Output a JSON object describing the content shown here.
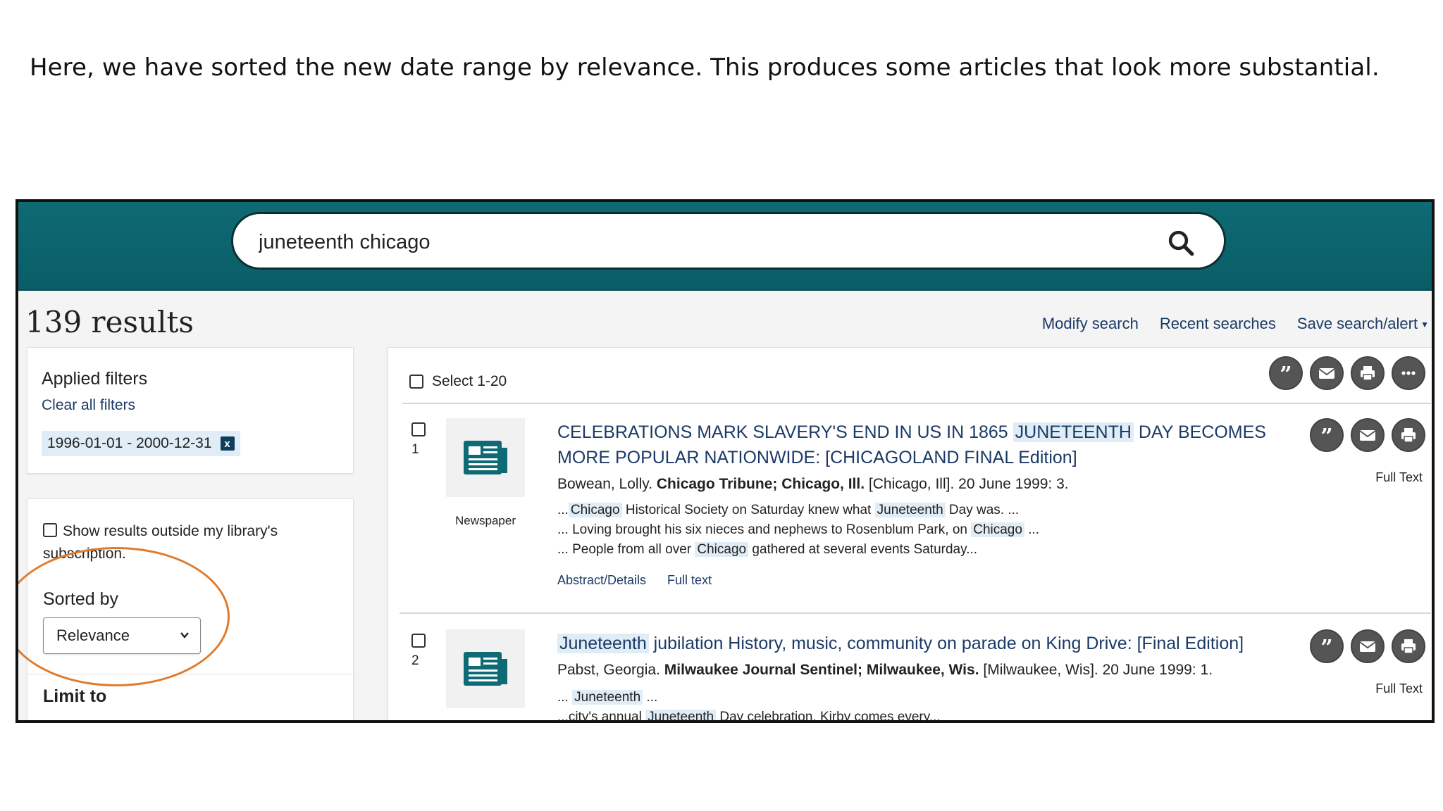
{
  "caption": "Here, we have sorted the new date range by relevance. This produces some articles that look more substantial.",
  "search": {
    "query": "juneteenth chicago"
  },
  "results_count": "139 results",
  "header_links": {
    "modify": "Modify search",
    "recent": "Recent searches",
    "save": "Save search/alert"
  },
  "filters": {
    "title": "Applied filters",
    "clear": "Clear all filters",
    "chip": "1996-01-01 - 2000-12-31",
    "chip_remove": "x"
  },
  "options": {
    "outside": "Show results outside my library's subscription.",
    "sorted_label": "Sorted by",
    "sort_value": "Relevance",
    "limit_label": "Limit to"
  },
  "toolbar": {
    "select_all": "Select 1-20"
  },
  "results": [
    {
      "number": "1",
      "type": "Newspaper",
      "title_pre": "CELEBRATIONS MARK SLAVERY'S END IN US IN 1865 ",
      "title_hl": "JUNETEENTH",
      "title_post": " DAY BECOMES MORE POPULAR NATIONWIDE: [CHICAGOLAND FINAL Edition]",
      "cite_author": "Bowean, Lolly.",
      "cite_pub": "Chicago Tribune; Chicago, Ill.",
      "cite_rest": "[Chicago, Ill]. 20 June 1999: 3.",
      "snip1_a": "...",
      "snip1_h1": "Chicago",
      "snip1_b": " Historical Society on Saturday knew what ",
      "snip1_h2": "Juneteenth",
      "snip1_c": " Day was. ...",
      "snip2_a": "... Loving brought his six nieces and nephews to Rosenblum Park, on ",
      "snip2_h1": "Chicago",
      "snip2_b": " ...",
      "snip3_a": "... People from all over ",
      "snip3_h1": "Chicago",
      "snip3_b": " gathered at several events Saturday...",
      "link_abstract": "Abstract/Details",
      "link_fulltext": "Full text",
      "fulltext_label": "Full Text"
    },
    {
      "number": "2",
      "title_hl": "Juneteenth",
      "title_post": " jubilation History, music, community on parade on King Drive: [Final Edition]",
      "cite_author": "Pabst, Georgia.",
      "cite_pub": "Milwaukee Journal Sentinel; Milwaukee, Wis.",
      "cite_rest": "[Milwaukee, Wis]. 20 June 1999: 1.",
      "snip1_a": "... ",
      "snip1_h1": "Juneteenth",
      "snip1_b": " ...",
      "snip2_a": "...city's annual ",
      "snip2_h1": "Juneteenth",
      "snip2_b": " Day celebration. Kirby comes every...",
      "fulltext_label": "Full Text"
    }
  ],
  "colors": {
    "banner": "#0e6a74",
    "link": "#1b3a66",
    "highlight": "#e0edf6",
    "annotation": "#e07a2c"
  }
}
